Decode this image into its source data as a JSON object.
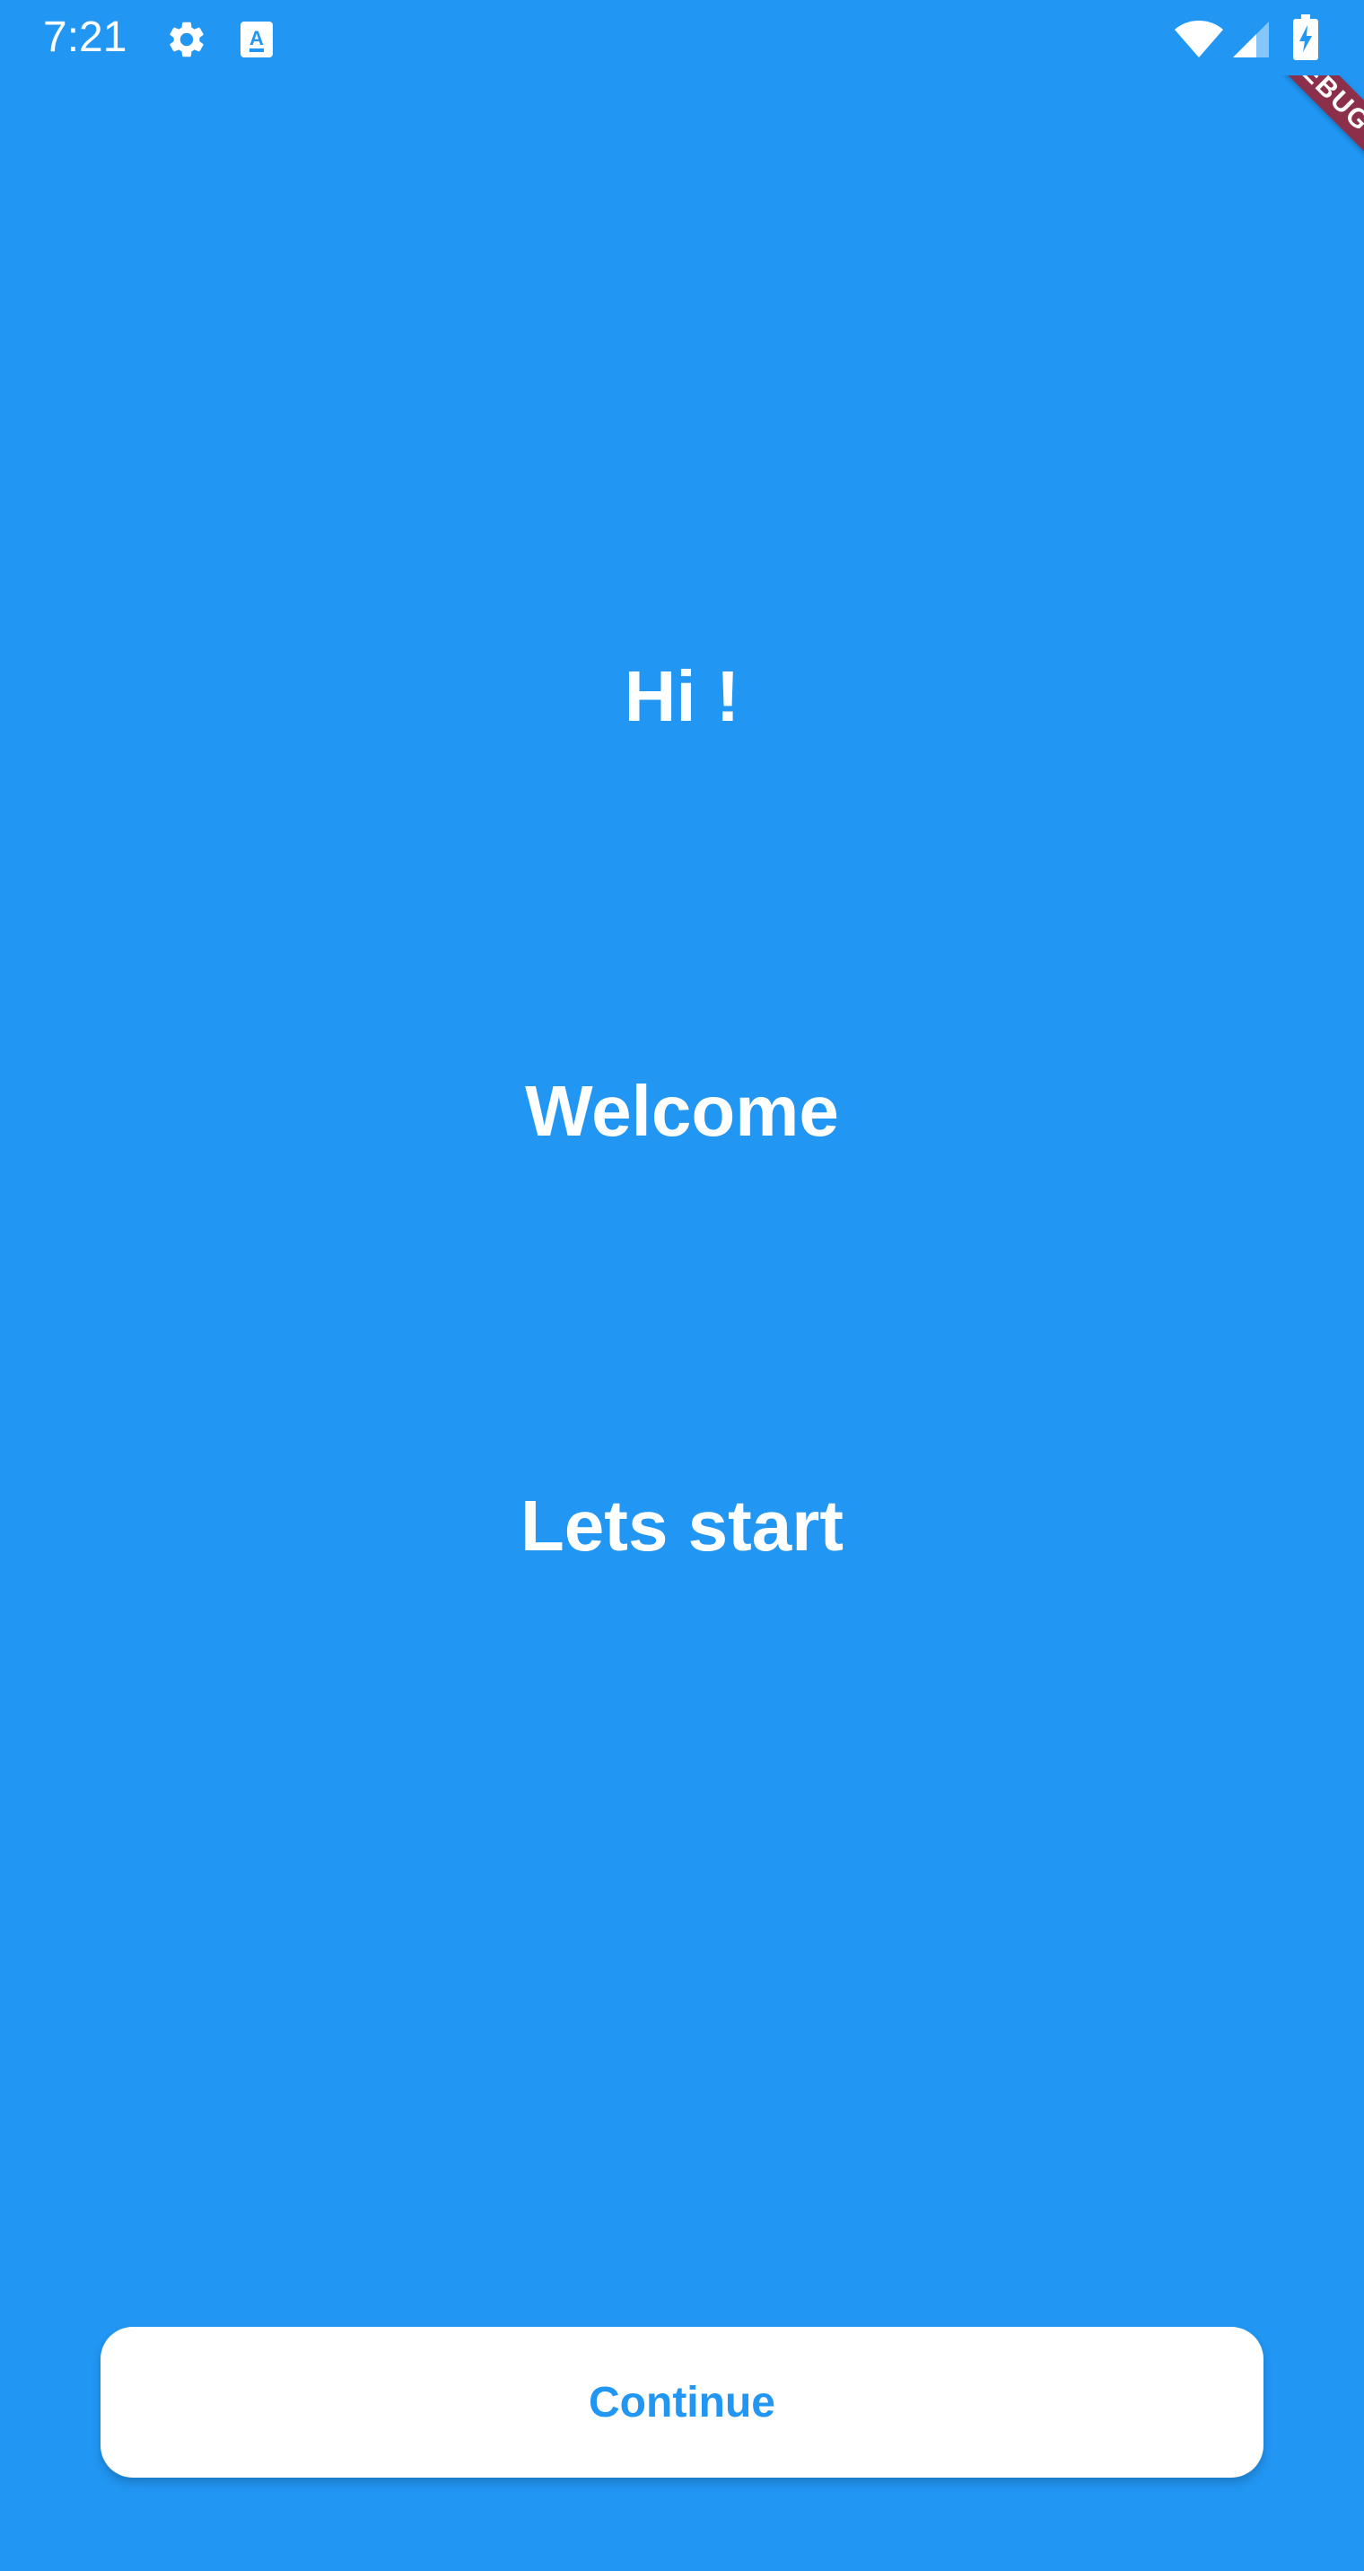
{
  "status_bar": {
    "time": "7:21",
    "icons": [
      "gear-icon",
      "keyboard-icon",
      "wifi-icon",
      "signal-icon",
      "battery-charging-icon"
    ]
  },
  "debug_banner": {
    "label": "DEBUG"
  },
  "main": {
    "greeting": "Hi !",
    "welcome": "Welcome",
    "start": "Lets start"
  },
  "footer": {
    "continue_label": "Continue"
  },
  "colors": {
    "background": "#2196F3",
    "text": "#FFFFFF",
    "button_background": "#FFFFFF",
    "button_text": "#2196F3",
    "debug_banner": "#8B2F4A"
  }
}
